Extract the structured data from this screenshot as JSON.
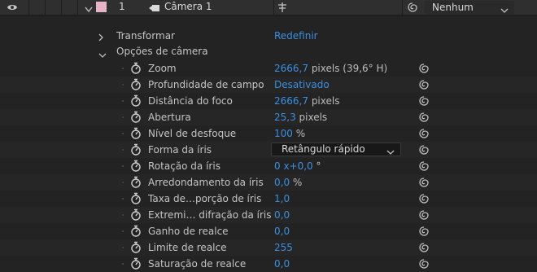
{
  "layer": {
    "number": "1",
    "name": "Câmera 1",
    "parent_value": "Nenhum",
    "label_color": "#e7b3c6",
    "eye_icon": "eye-icon",
    "camera_icon": "camera-icon",
    "pickwhip_icon": "pickwhip-icon"
  },
  "groups": {
    "transform": {
      "label": "Transformar",
      "action": "Redefinir"
    },
    "camera_options": {
      "label": "Opções de câmera"
    }
  },
  "properties": [
    {
      "label": "Zoom",
      "value": "2666,7",
      "unit": " pixels (39,6° H)"
    },
    {
      "label": "Profundidade de campo",
      "value": "Desativado",
      "unit": ""
    },
    {
      "label": "Distância do foco",
      "value": "2666,7",
      "unit": " pixels"
    },
    {
      "label": "Abertura",
      "value": "25,3",
      "unit": " pixels"
    },
    {
      "label": "Nível de desfoque",
      "value": "100",
      "unit": " %"
    },
    {
      "label": "Forma da íris",
      "value": "Retângulo rápido",
      "unit": ""
    },
    {
      "label": "Rotação da íris",
      "value": "0 x+0,0",
      "unit": " °"
    },
    {
      "label": "Arredondamento da íris",
      "value": "0,0",
      "unit": " %"
    },
    {
      "label": "Taxa de…porção de íris",
      "value": "1,0",
      "unit": ""
    },
    {
      "label": "Extremi… difração da íris",
      "value": "0,0",
      "unit": ""
    },
    {
      "label": "Ganho de realce",
      "value": "0,0",
      "unit": ""
    },
    {
      "label": "Limite de realce",
      "value": "255",
      "unit": ""
    },
    {
      "label": "Saturação de realce",
      "value": "0,0",
      "unit": ""
    }
  ],
  "colors": {
    "value_blue": "#3b8fe0",
    "background": "#232323",
    "header_bg": "#2f2f2f"
  }
}
